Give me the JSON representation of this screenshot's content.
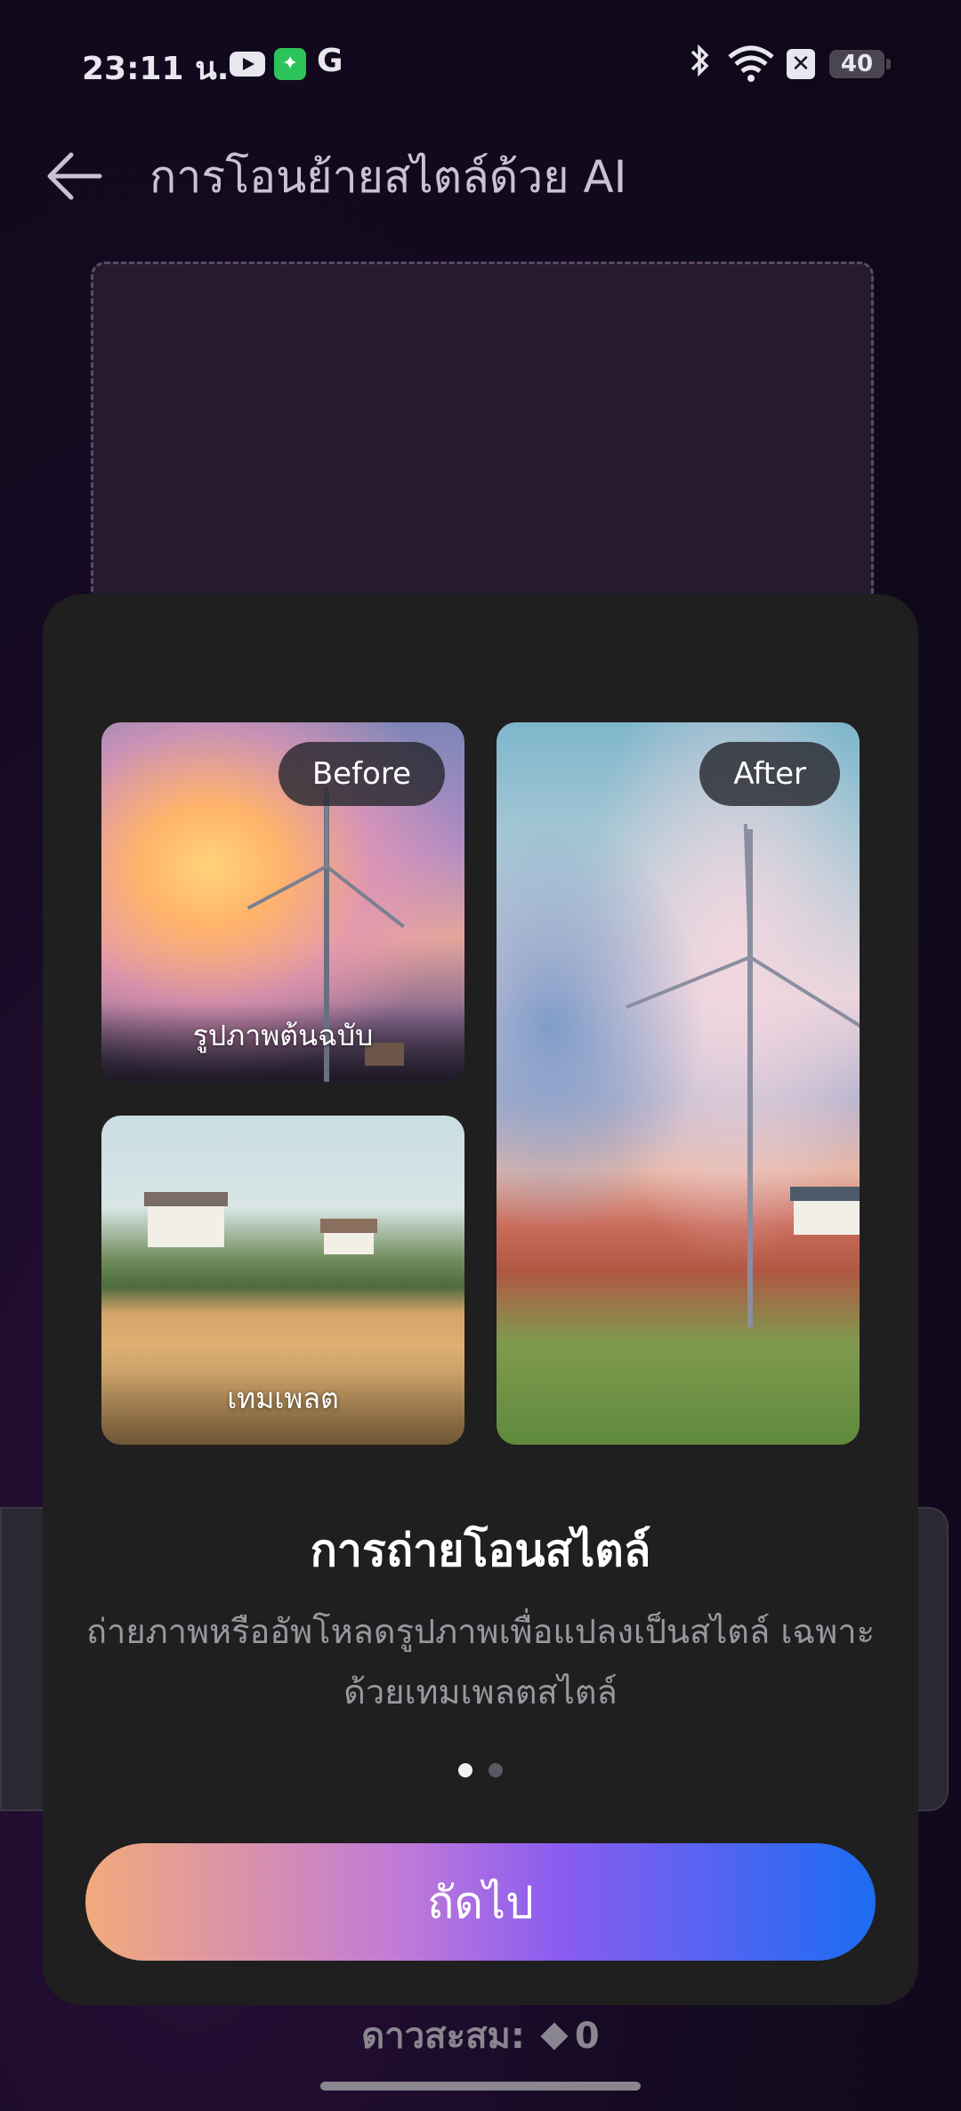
{
  "status_bar": {
    "time": "23:11 น.",
    "g_label": "G",
    "x_label": "✕",
    "battery": "40"
  },
  "header": {
    "back_icon": "arrow-left-icon",
    "title": "การโอนย้ายสไตล์ด้วย AI"
  },
  "modal": {
    "before_badge": "Before",
    "after_badge": "After",
    "original_label": "รูปภาพต้นฉบับ",
    "template_label": "เทมเพลต",
    "title": "การถ่ายโอนสไตล์",
    "description": "ถ่ายภาพหรืออัพโหลดรูปภาพเพื่อแปลงเป็นสไตล์ เฉพาะด้วยเทมเพลตสไตล์",
    "page_count": 2,
    "current_page": 1,
    "next_button": "ถัดไป"
  },
  "footer": {
    "stars_label": "ดาวสะสม:",
    "stars_value": "0"
  },
  "colors": {
    "background": "#150a22",
    "modal": "#1f1f1f",
    "button_gradient_start": "#f2aa7c",
    "button_gradient_mid": "#8a5cf0",
    "button_gradient_end": "#1b6cf2"
  }
}
